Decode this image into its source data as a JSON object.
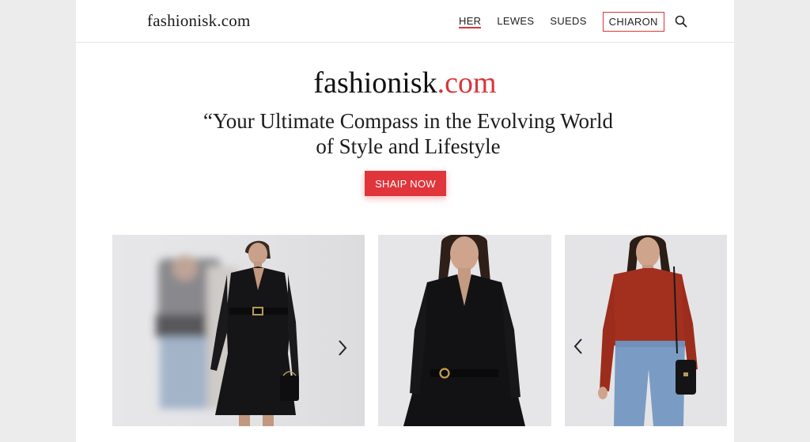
{
  "header": {
    "brand": "fashionisk.com",
    "nav": [
      {
        "label": "HER",
        "active": true
      },
      {
        "label": "LEWES",
        "active": false
      },
      {
        "label": "SUEDS",
        "active": false
      },
      {
        "label": "CHIARON",
        "boxed": true
      }
    ],
    "search_icon": "search-icon"
  },
  "hero": {
    "brand_name": "fashionisk",
    "brand_tld": ".com",
    "tagline": "“Your Ultimate Compass in the Evolving World of Style and Lifestyle",
    "cta_label": "SHAIP NOW"
  },
  "carousel": {
    "items": [
      {
        "outfit": "black belted wrap dress with black handbag",
        "has_motion_blur": true,
        "arrow": "chevron-right-icon"
      },
      {
        "outfit": "black belted shirt dress with gold buckle"
      },
      {
        "outfit": "red knit sweater, light blue jeans, black shoulder bag",
        "arrow": "chevron-left-icon"
      }
    ]
  },
  "colors": {
    "accent": "#e0353b",
    "background": "#ececec",
    "page": "#ffffff"
  }
}
